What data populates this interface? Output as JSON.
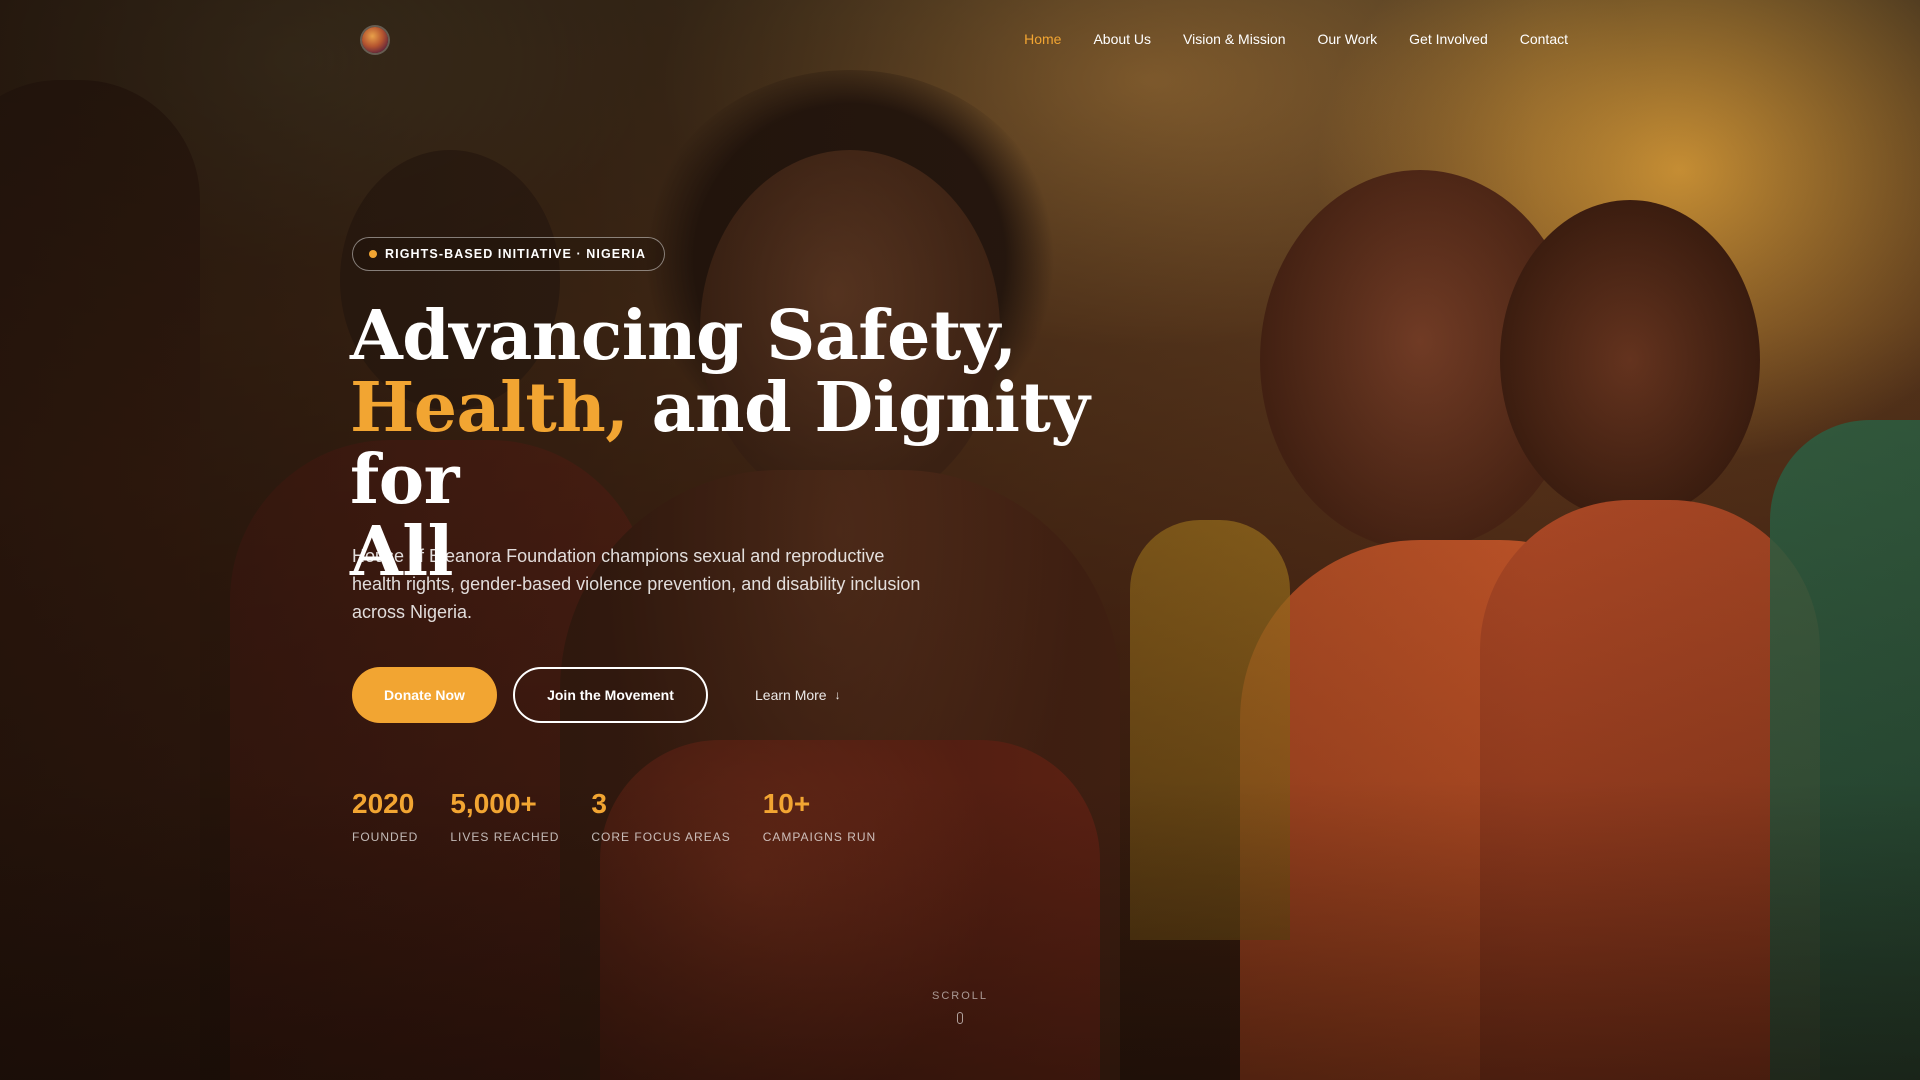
{
  "nav": {
    "logo_name": "house-of-eleanora-logo",
    "links": [
      {
        "label": "Home",
        "active": true
      },
      {
        "label": "About Us",
        "active": false
      },
      {
        "label": "Vision & Mission",
        "active": false
      },
      {
        "label": "Our Work",
        "active": false
      },
      {
        "label": "Get Involved",
        "active": false
      },
      {
        "label": "Contact",
        "active": false
      }
    ]
  },
  "hero": {
    "badge": "RIGHTS-BASED INITIATIVE · NIGERIA",
    "headline": {
      "line1": "Advancing Safety,",
      "accent": "Health,",
      "line2_rest": " and Dignity for",
      "line3": "All"
    },
    "subtitle": "House of Eleanora Foundation champions sexual and reproductive health rights, gender-based violence prevention, and disability inclusion across Nigeria.",
    "buttons": {
      "donate": "Donate Now",
      "join": "Join the Movement",
      "learn": "Learn More"
    },
    "stats": [
      {
        "value": "2020",
        "label": "FOUNDED"
      },
      {
        "value": "5,000+",
        "label": "LIVES REACHED"
      },
      {
        "value": "3",
        "label": "CORE FOCUS AREAS"
      },
      {
        "value": "10+",
        "label": "CAMPAIGNS RUN"
      }
    ],
    "scroll_label": "SCROLL"
  },
  "colors": {
    "accent": "#f2a532",
    "text": "#ffffff"
  },
  "icons": {
    "learn_more": "arrow-down-icon",
    "scroll": "mouse-icon"
  }
}
